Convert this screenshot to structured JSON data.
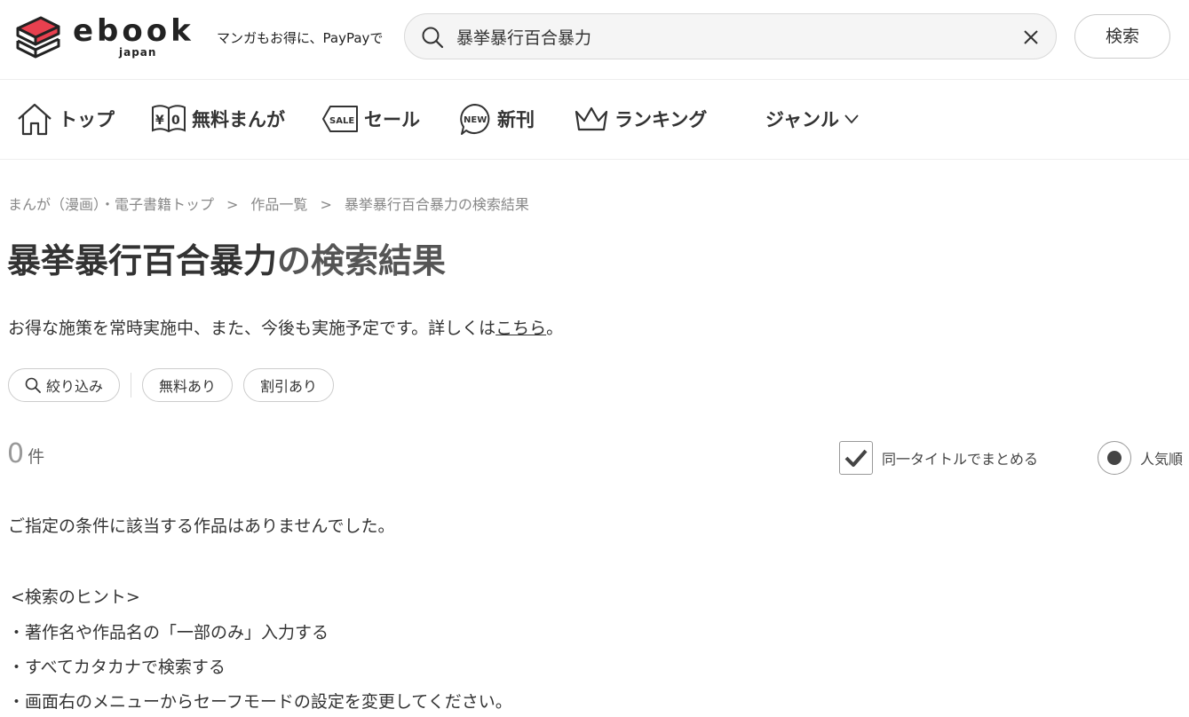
{
  "header": {
    "logo_word": "ebook",
    "logo_sub": "japan",
    "tagline": "マンガもお得に、PayPayで",
    "search_value": "暴挙暴行百合暴力",
    "search_button": "検索",
    "colors": {
      "logo_red": "#e8404f",
      "logo_dark": "#222222"
    }
  },
  "nav": {
    "items": [
      {
        "label": "トップ",
        "icon": "home-icon"
      },
      {
        "label": "無料まんが",
        "icon": "free-book-icon"
      },
      {
        "label": "セール",
        "icon": "sale-tag-icon"
      },
      {
        "label": "新刊",
        "icon": "new-badge-icon"
      },
      {
        "label": "ランキング",
        "icon": "crown-icon"
      },
      {
        "label": "ジャンル",
        "icon": "chevron-down-icon"
      }
    ]
  },
  "breadcrumb": {
    "items": [
      "まんが（漫画）・電子書籍トップ",
      "作品一覧",
      "暴挙暴行百合暴力の検索結果"
    ],
    "separator": ">"
  },
  "main": {
    "title_keyword": "暴挙暴行百合暴力",
    "title_suffix": "の検索結果",
    "promo_text": "お得な施策を常時実施中、また、今後も実施予定です。詳しくは",
    "promo_link": "こちら",
    "promo_end": "。",
    "filters": {
      "narrow": "絞り込み",
      "free": "無料あり",
      "discount": "割引あり"
    },
    "count": "0",
    "count_unit": "件",
    "group_label": "同一タイトルでまとめる",
    "group_checked": true,
    "sort_label": "人気順",
    "no_result": "ご指定の条件に該当する作品はありませんでした。",
    "hint_title": "<検索のヒント>",
    "hints": [
      "・著作名や作品名の「一部のみ」入力する",
      "・すべてカタカナで検索する",
      "・画面右のメニューからセーフモードの設定を変更してください。"
    ]
  }
}
